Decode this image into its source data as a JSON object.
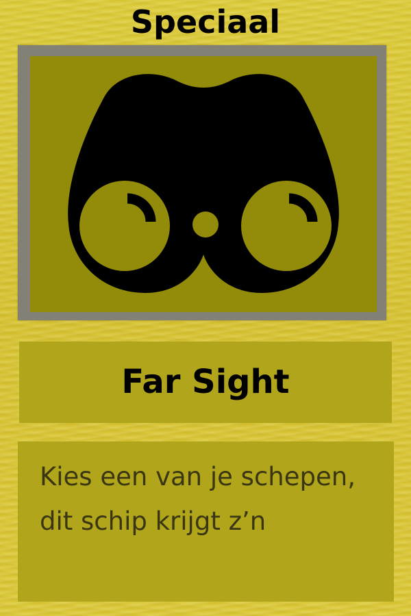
{
  "card": {
    "category": "Speciaal",
    "name": "Far Sight",
    "description": [
      "Kies een van je schepen,",
      "dit schip krijgt z’n"
    ],
    "icon": "binoculars-icon",
    "colors": {
      "background": "#d8c636",
      "frame": "#838176",
      "art_background": "#938b0a",
      "panel": "#b1a51b",
      "title_text": "#000000",
      "description_text": "#3a3612"
    }
  }
}
